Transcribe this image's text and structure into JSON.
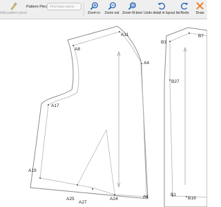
{
  "toolbar": {
    "pattern_piece_label": "Pattern Piece:",
    "pattern_piece_placeholder": "Find base piece",
    "buttons": {
      "add_pattern_piece": "Add pattern piece",
      "zoom_in": "Zoom in",
      "zoom_out": "Zoom out",
      "zoom_fit_best": "Zoom fit best",
      "undo_detail": "Undo detail in layout list",
      "redo": "Redo",
      "draw": "Draw"
    },
    "colors": {
      "icon_blue": "#1f5fb5",
      "draw_orange": "#e87a1d"
    }
  },
  "points": {
    "a11": "A11",
    "a8": "A8",
    "a4": "A4",
    "a17": "A17",
    "a19": "A19",
    "a25": "A25",
    "a27": "A27",
    "a24": "A24",
    "a1": "A1",
    "b3": "B3",
    "b7": "B7",
    "b27": "B27",
    "b1": "B1",
    "b19": "B19"
  }
}
